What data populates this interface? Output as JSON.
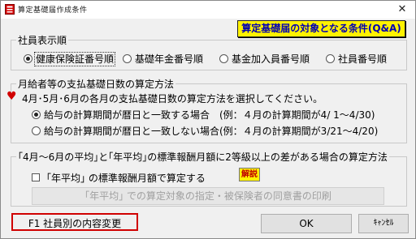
{
  "window": {
    "title": "算定基礎届作成条件",
    "close_glyph": "✕",
    "qa_button": "算定基礎届の対象となる条件(Q&A)"
  },
  "display_order": {
    "legend": "社員表示順",
    "options": [
      "健康保険証番号順",
      "基礎年金番号順",
      "基金加入員番号順",
      "社員番号順"
    ],
    "selected": "健康保険証番号順"
  },
  "payment_days": {
    "legend": "月給者等の支払基礎日数の算定方法",
    "instruction": "4月･5月･6月の各月の支払基礎日数の算定方法を選択してください。",
    "options": [
      "給与の計算期間が暦日と一致する場合　(例：４月の計算期間が4/ 1～4/30)",
      "給与の計算期間が暦日と一致しない場合(例：４月の計算期間が3/21～4/20)"
    ],
    "selected": "給与の計算期間が暦日と一致する場合　(例：４月の計算期間が4/ 1～4/30)"
  },
  "average_method": {
    "legend": "｢4月～6月の平均｣と｢年平均｣の標準報酬月額に2等級以上の差がある場合の算定方法",
    "checkbox_label": "｢年平均｣ の標準報酬月額で算定する",
    "checked": false,
    "explain_button": "解説",
    "print_button": "｢年平均｣ での算定対象の指定・被保険者の同意書の印刷"
  },
  "footer": {
    "f1_button": "F1  社員別の内容変更",
    "ok_button": "OK",
    "cancel_button": "ｷｬﾝｾﾙ"
  },
  "colors": {
    "qa_bg": "#fff200",
    "qa_text": "#0000b4",
    "heart": "#d10000",
    "f1_border": "#d00000"
  },
  "icons": {
    "heart": "♥"
  }
}
